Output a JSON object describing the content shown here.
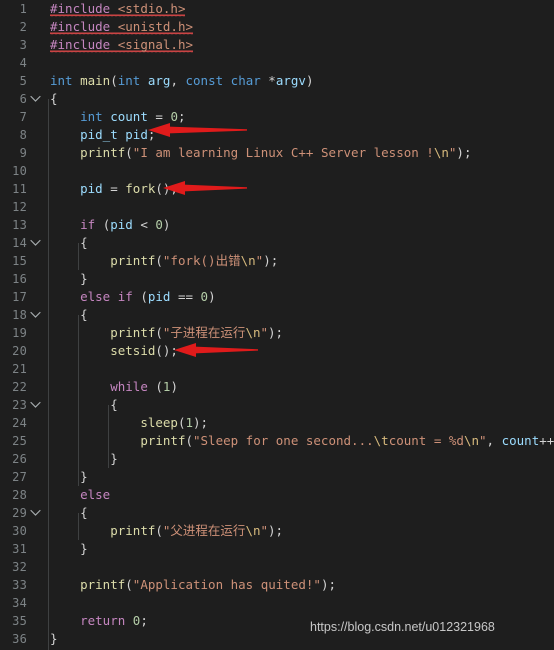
{
  "editor": {
    "background": "#1e1e1e",
    "gutter_color": "#7d8386",
    "total_lines": 36,
    "language": "C"
  },
  "colors": {
    "preprocessor": "#c586c0",
    "header_path": "#ce9178",
    "keyword": "#569cd6",
    "control": "#c586c0",
    "function": "#dcdcaa",
    "variable": "#9cdcfe",
    "number": "#b5cea8",
    "string": "#ce9178",
    "escape": "#d7ba7d",
    "punctuation": "#d4d4d4",
    "error_squiggle": "#f14c4c",
    "annotation_arrow": "#e01b1b",
    "indent_guide": "#3f4142"
  },
  "gutter": {
    "line_numbers": [
      "1",
      "2",
      "3",
      "4",
      "5",
      "6",
      "7",
      "8",
      "9",
      "10",
      "11",
      "12",
      "13",
      "14",
      "15",
      "16",
      "17",
      "18",
      "19",
      "20",
      "21",
      "22",
      "23",
      "24",
      "25",
      "26",
      "27",
      "28",
      "29",
      "30",
      "31",
      "32",
      "33",
      "34",
      "35",
      "36"
    ],
    "fold_markers": [
      6,
      14,
      18,
      23,
      29
    ],
    "fold_icon": "chevron-down-icon"
  },
  "code": {
    "lines": [
      "#include <stdio.h>",
      "#include <unistd.h>",
      "#include <signal.h>",
      "",
      "int main(int arg, const char *argv)",
      "{",
      "    int count = 0;",
      "    pid_t pid;",
      "    printf(\"I am learning Linux C++ Server lesson !\\n\");",
      "",
      "    pid = fork();",
      "",
      "    if (pid < 0)",
      "    {",
      "        printf(\"fork()出错\\n\");",
      "    }",
      "    else if (pid == 0)",
      "    {",
      "        printf(\"子进程在运行\\n\");",
      "        setsid();",
      "",
      "        while (1)",
      "        {",
      "            sleep(1);",
      "            printf(\"Sleep for one second...\\tcount = %d\\n\", count++);",
      "        }",
      "    }",
      "    else",
      "    {",
      "        printf(\"父进程在运行\\n\");",
      "    }",
      "",
      "    printf(\"Application has quited!\");",
      "",
      "    return 0;",
      "}"
    ],
    "error_underlined_lines": [
      1,
      2,
      3
    ]
  },
  "annotations": {
    "arrows": [
      {
        "name": "arrow-pid-declaration",
        "target_line": 8,
        "target_text": "pid_t pid;",
        "direction": "left"
      },
      {
        "name": "arrow-fork-call",
        "target_line": 11,
        "target_text": "pid = fork();",
        "direction": "left"
      },
      {
        "name": "arrow-setsid-call",
        "target_line": 20,
        "target_text": "setsid();",
        "direction": "left"
      }
    ]
  },
  "watermark": {
    "text": "https://blog.csdn.net/u012321968"
  }
}
